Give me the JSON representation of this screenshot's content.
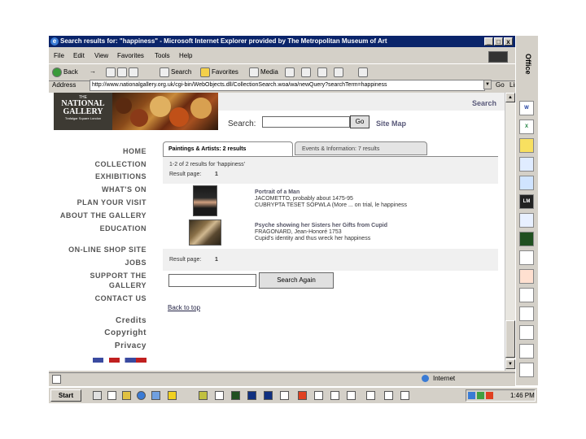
{
  "window": {
    "title": "Search results for: \"happiness\" - Microsoft Internet Explorer provided by The Metropolitan Museum of Art",
    "minimize": "_",
    "maximize": "□",
    "close": "x"
  },
  "menu": [
    "File",
    "Edit",
    "View",
    "Favorites",
    "Tools",
    "Help"
  ],
  "toolbar": {
    "back": "Back",
    "forward": "→",
    "search": "Search",
    "favorites": "Favorites",
    "media": "Media"
  },
  "address": {
    "label": "Address",
    "url": "http://www.nationalgallery.org.uk/cgi-bin/WebObjects.dll/CollectionSearch.woa/wa/newQuery?searchTerm=happiness",
    "go": "Go",
    "links": "Links"
  },
  "site": {
    "logo_line1": "THE",
    "logo_line2": "NATIONAL",
    "logo_line3": "GALLERY",
    "logo_line4": "Trafalgar Square London",
    "search_link": "Search",
    "search_label": "Search:",
    "go_button": "Go",
    "site_map": "Site Map"
  },
  "nav": [
    "HOME",
    "COLLECTION",
    "EXHIBITIONS",
    "WHAT'S ON",
    "PLAN YOUR VISIT",
    "ABOUT THE GALLERY",
    "EDUCATION",
    "ON-LINE SHOP SITE",
    "JOBS",
    "SUPPORT THE",
    "GALLERY",
    "CONTACT US",
    "Credits",
    "Copyright",
    "Privacy"
  ],
  "tabs": {
    "active": "Paintings & Artists: 2 results",
    "inactive": "Events & Information: 7 results"
  },
  "results": {
    "summary": "1-2 of 2 results for 'happiness'",
    "page_label": "Result page:",
    "page_number": "1",
    "items": [
      {
        "title": "Portrait of a Man",
        "artist": "JACOMETTO, probably about 1475-95",
        "note": "CUBRYPTA TESET SOPWLA (More ... on trial, le happiness"
      },
      {
        "title": "Psyche showing her Sisters her Gifts from Cupid",
        "artist": "FRAGONARD, Jean-Honoré 1753",
        "note": "Cupid's identity and thus wreck her happiness"
      }
    ],
    "search_again": "Search Again",
    "back_to_top": "Back to top"
  },
  "status": {
    "zone": "Internet"
  },
  "officebar": {
    "label": "Office"
  },
  "taskbar": {
    "start": "Start",
    "clock": "1:46 PM"
  }
}
